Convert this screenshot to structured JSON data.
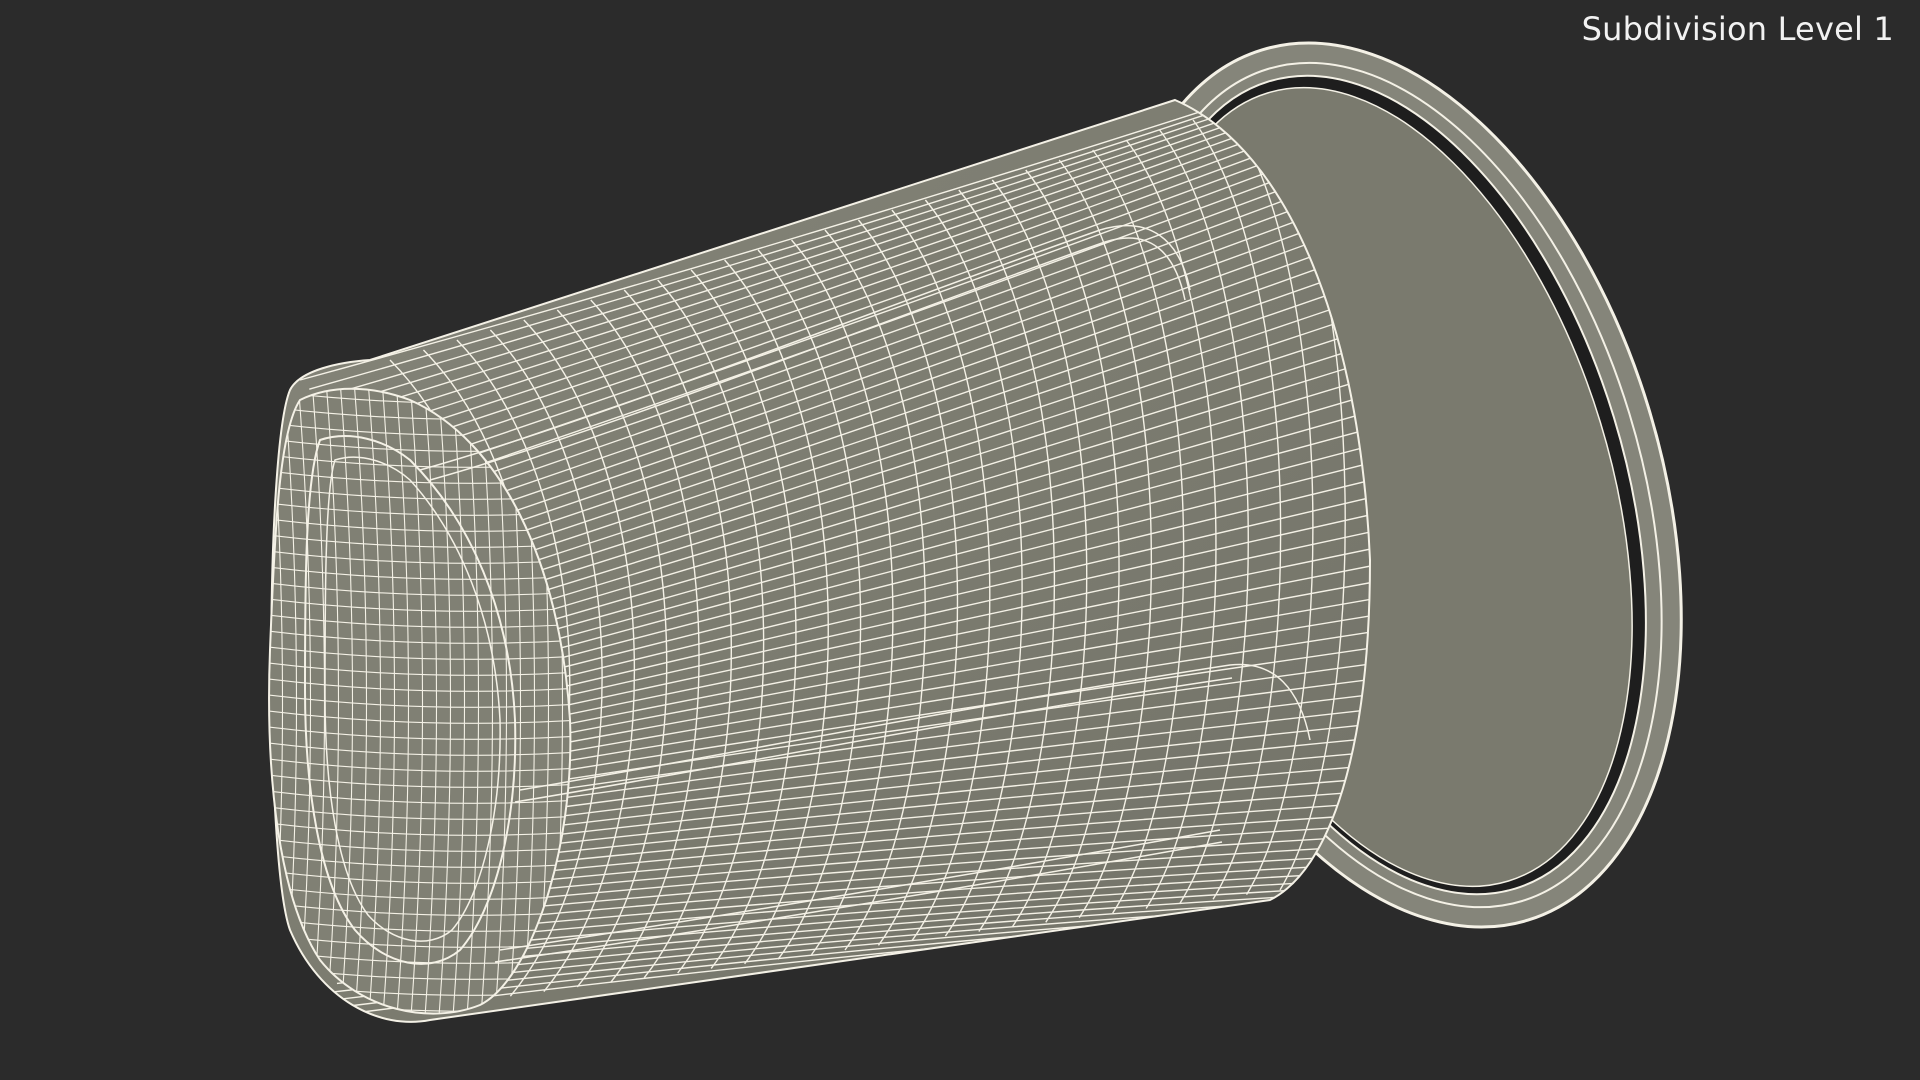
{
  "viewport": {
    "overlay_label": "Subdivision Level 1",
    "background_color": "#2b2b2b"
  },
  "model": {
    "object": "cup",
    "display_mode": "wireframe-on-shaded",
    "surface_color": "#7d7d70",
    "wire_color": "#f4f1e6"
  }
}
